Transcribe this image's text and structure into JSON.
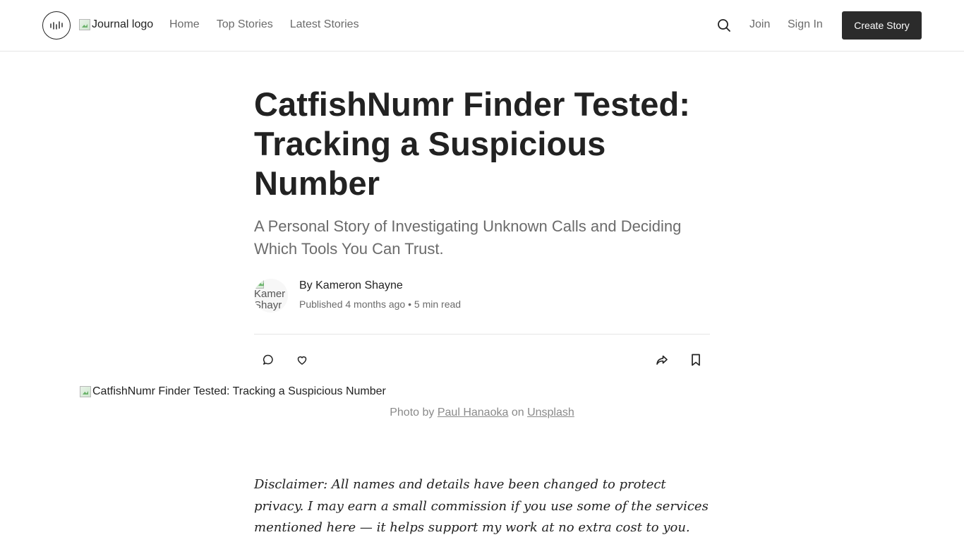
{
  "header": {
    "logo_alt": "Journal logo",
    "nav": [
      "Home",
      "Top Stories",
      "Latest Stories"
    ],
    "join": "Join",
    "sign_in": "Sign In",
    "create_story": "Create Story",
    "icons": {
      "brand": "waveform-icon",
      "search": "search-icon"
    }
  },
  "article": {
    "title": "CatfishNumr Finder Tested: Tracking a Suspicious Number",
    "subtitle": "A Personal Story of Investigating Unknown Calls and Deciding Which Tools You Can Trust.",
    "author": {
      "avatar_alt_line1": "Kamer",
      "avatar_alt_line2": "Shayr",
      "byline": "By Kameron Shayne",
      "published": "Published 4 months ago",
      "separator": "•",
      "read_time": "5 min read"
    },
    "actions": {
      "comment": "comment-icon",
      "like": "heart-icon",
      "share": "share-icon",
      "bookmark": "bookmark-icon"
    },
    "hero": {
      "alt": "CatfishNumr Finder Tested: Tracking a Suspicious Number",
      "caption_prefix": "Photo by",
      "photographer": "Paul Hanaoka",
      "caption_mid": "on",
      "source": "Unsplash"
    },
    "disclaimer": "Disclaimer: All names and details have been changed to protect privacy. I may earn a small commission if you use some of the services mentioned here — it helps support my work at no extra cost to you."
  }
}
